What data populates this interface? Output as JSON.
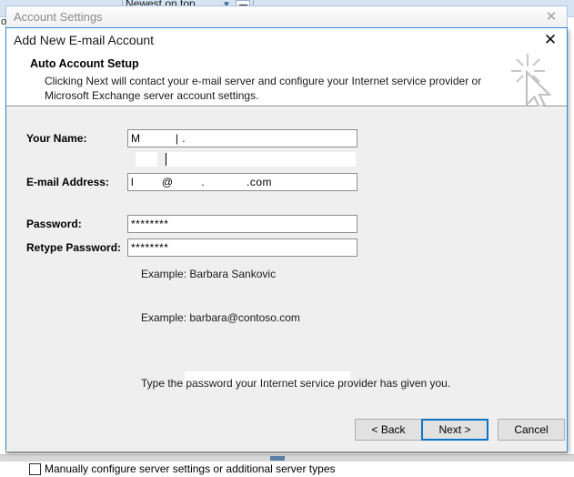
{
  "background": {
    "sort_label": "Newest on top",
    "combo_arrow_icon": "chevron-down-icon",
    "minimize_icon": "minimize-icon",
    "left_edge_fragment": "o"
  },
  "account_settings_window": {
    "title": "Account Settings",
    "close_label": "✕"
  },
  "dialog": {
    "title": "Add New E-mail Account",
    "close_label": "✕",
    "header": {
      "heading": "Auto Account Setup",
      "description": "Clicking Next will contact your e-mail server and configure your Internet service provider or Microsoft Exchange server account settings."
    },
    "fields": [
      {
        "label": "Your Name:",
        "value": "M          | .",
        "example": "Example: Barbara Sankovic"
      },
      {
        "label": "E-mail Address:",
        "value": "l        @        .            .com",
        "example": "Example: barbara@contoso.com"
      },
      {
        "label": "Password:",
        "value": "********",
        "example": ""
      },
      {
        "label": "Retype Password:",
        "value": "********",
        "example": "Type the password your Internet service provider has given you."
      }
    ],
    "checkbox": {
      "label": "Manually configure server settings or additional server types",
      "checked": false
    },
    "buttons": {
      "back": "< Back",
      "next": "Next >",
      "cancel": "Cancel"
    }
  },
  "colors": {
    "dialog_border": "#2e8ad4",
    "default_button_border": "#0a74c8",
    "body_background": "#efefef",
    "title_text": "#1a1a1a",
    "inactive_title_text": "#8b8b8b"
  }
}
